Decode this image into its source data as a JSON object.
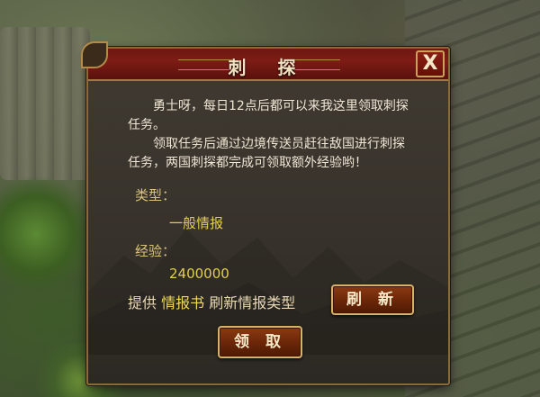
{
  "dialog": {
    "title": "刺  探",
    "close_symbol": "X",
    "paragraph1": "勇士呀，每日12点后都可以来我这里领取刺探任务。",
    "paragraph2": "领取任务后通过边境传送员赶往敌国进行刺探任务，两国刺探都完成可领取额外经验哟！",
    "type_label": "类型：",
    "type_value": "一般情报",
    "exp_label": "经验：",
    "exp_value": "2400000",
    "info_prefix": "提供",
    "info_link": "情报书",
    "info_suffix": "刷新情报类型",
    "refresh_label": "刷 新",
    "claim_label": "领 取"
  },
  "icons": {
    "close": "close-icon"
  },
  "colors": {
    "title_bar": "#7d1c15",
    "panel_bg": "#3a342c",
    "border_gold": "#c9a25c",
    "value_yellow": "#e2cf4e",
    "label_tan": "#d8c27a"
  }
}
